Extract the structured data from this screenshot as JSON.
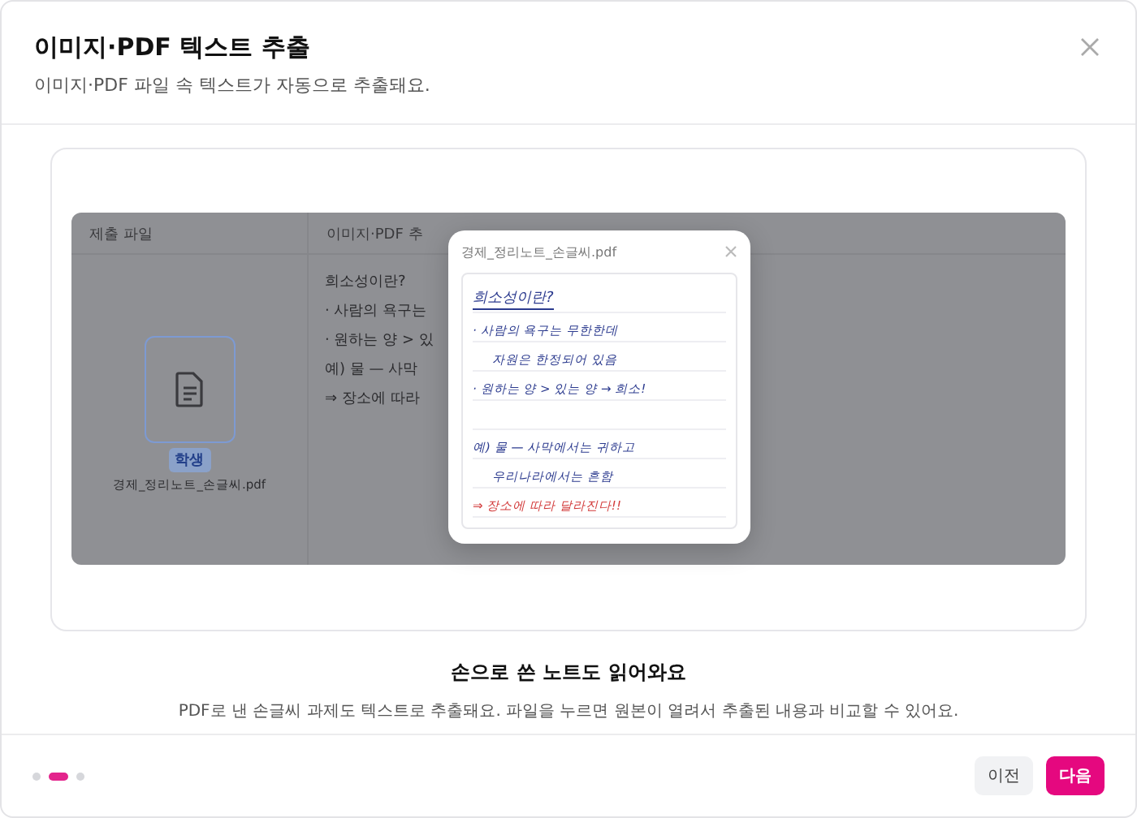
{
  "dialog": {
    "title": "이미지·PDF 텍스트 추출",
    "subtitle": "이미지·PDF 파일 속 텍스트가 자동으로 추출돼요."
  },
  "preview": {
    "columns": [
      "제출 파일",
      "이미지·PDF 추"
    ],
    "file": {
      "badge": "학생",
      "name": "경제_정리노트_손글씨.pdf"
    },
    "extracted_lines": [
      "희소성이란?",
      "· 사람의 욕구는",
      "· 원하는 양 > 있",
      "예) 물 — 사막",
      "⇒ 장소에 따라"
    ],
    "popup": {
      "title": "경제_정리노트_손글씨.pdf",
      "lines": [
        {
          "kind": "heading",
          "text": "희소성이란?"
        },
        {
          "kind": "text",
          "text": "· 사람의 욕구는 무한한데"
        },
        {
          "kind": "indented",
          "text": "자원은 한정되어 있음"
        },
        {
          "kind": "text",
          "text": "· 원하는 양 > 있는 양 → 희소!"
        },
        {
          "kind": "gap"
        },
        {
          "kind": "text",
          "text": "예) 물 — 사막에서는 귀하고"
        },
        {
          "kind": "indented",
          "text": "우리나라에서는 흔함"
        },
        {
          "kind": "emphasis",
          "text": "⇒ 장소에 따라 달라진다!!"
        }
      ]
    }
  },
  "caption": {
    "title": "손으로 쓴 노트도 읽어와요",
    "text": "PDF로 낸 손글씨 과제도 텍스트로 추출돼요. 파일을 누르면 원본이 열려서 추출된 내용과 비교할 수 있어요."
  },
  "steps": [
    {
      "selected": false
    },
    {
      "selected": true
    },
    {
      "selected": false
    }
  ],
  "buttons": {
    "previous": "이전",
    "next": "다음"
  }
}
